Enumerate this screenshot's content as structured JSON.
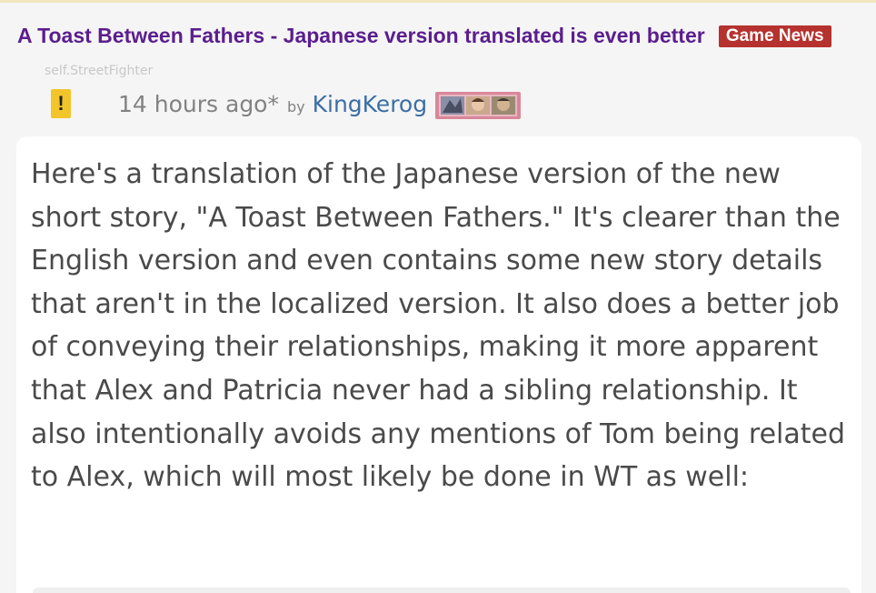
{
  "post": {
    "title": "A Toast Between Fathers - Japanese version translated is even better",
    "flair": "Game News",
    "domain": "self.StreetFighter"
  },
  "meta": {
    "warning_glyph": "!",
    "time": "14 hours ago*",
    "by": "by",
    "author": "KingKerog",
    "user_flair_icon": "character-portraits-icon"
  },
  "body": {
    "text": "Here's a translation of the Japanese version of the new short story, \"A Toast Between Fathers.\" It's clearer than the English version and even contains some new story details that aren't in the localized version. It also does a better job of conveying their relationships, making it more apparent that Alex and Patricia never had a sibling relationship. It also intentionally avoids any mentions of Tom being related to Alex, which will most likely be done in WT as well:"
  },
  "colors": {
    "title": "#5b1e8e",
    "flair_bg": "#b5322f",
    "warning": "#f2c52a",
    "author": "#3b6fa3",
    "user_flair_bg": "#d9869a"
  }
}
